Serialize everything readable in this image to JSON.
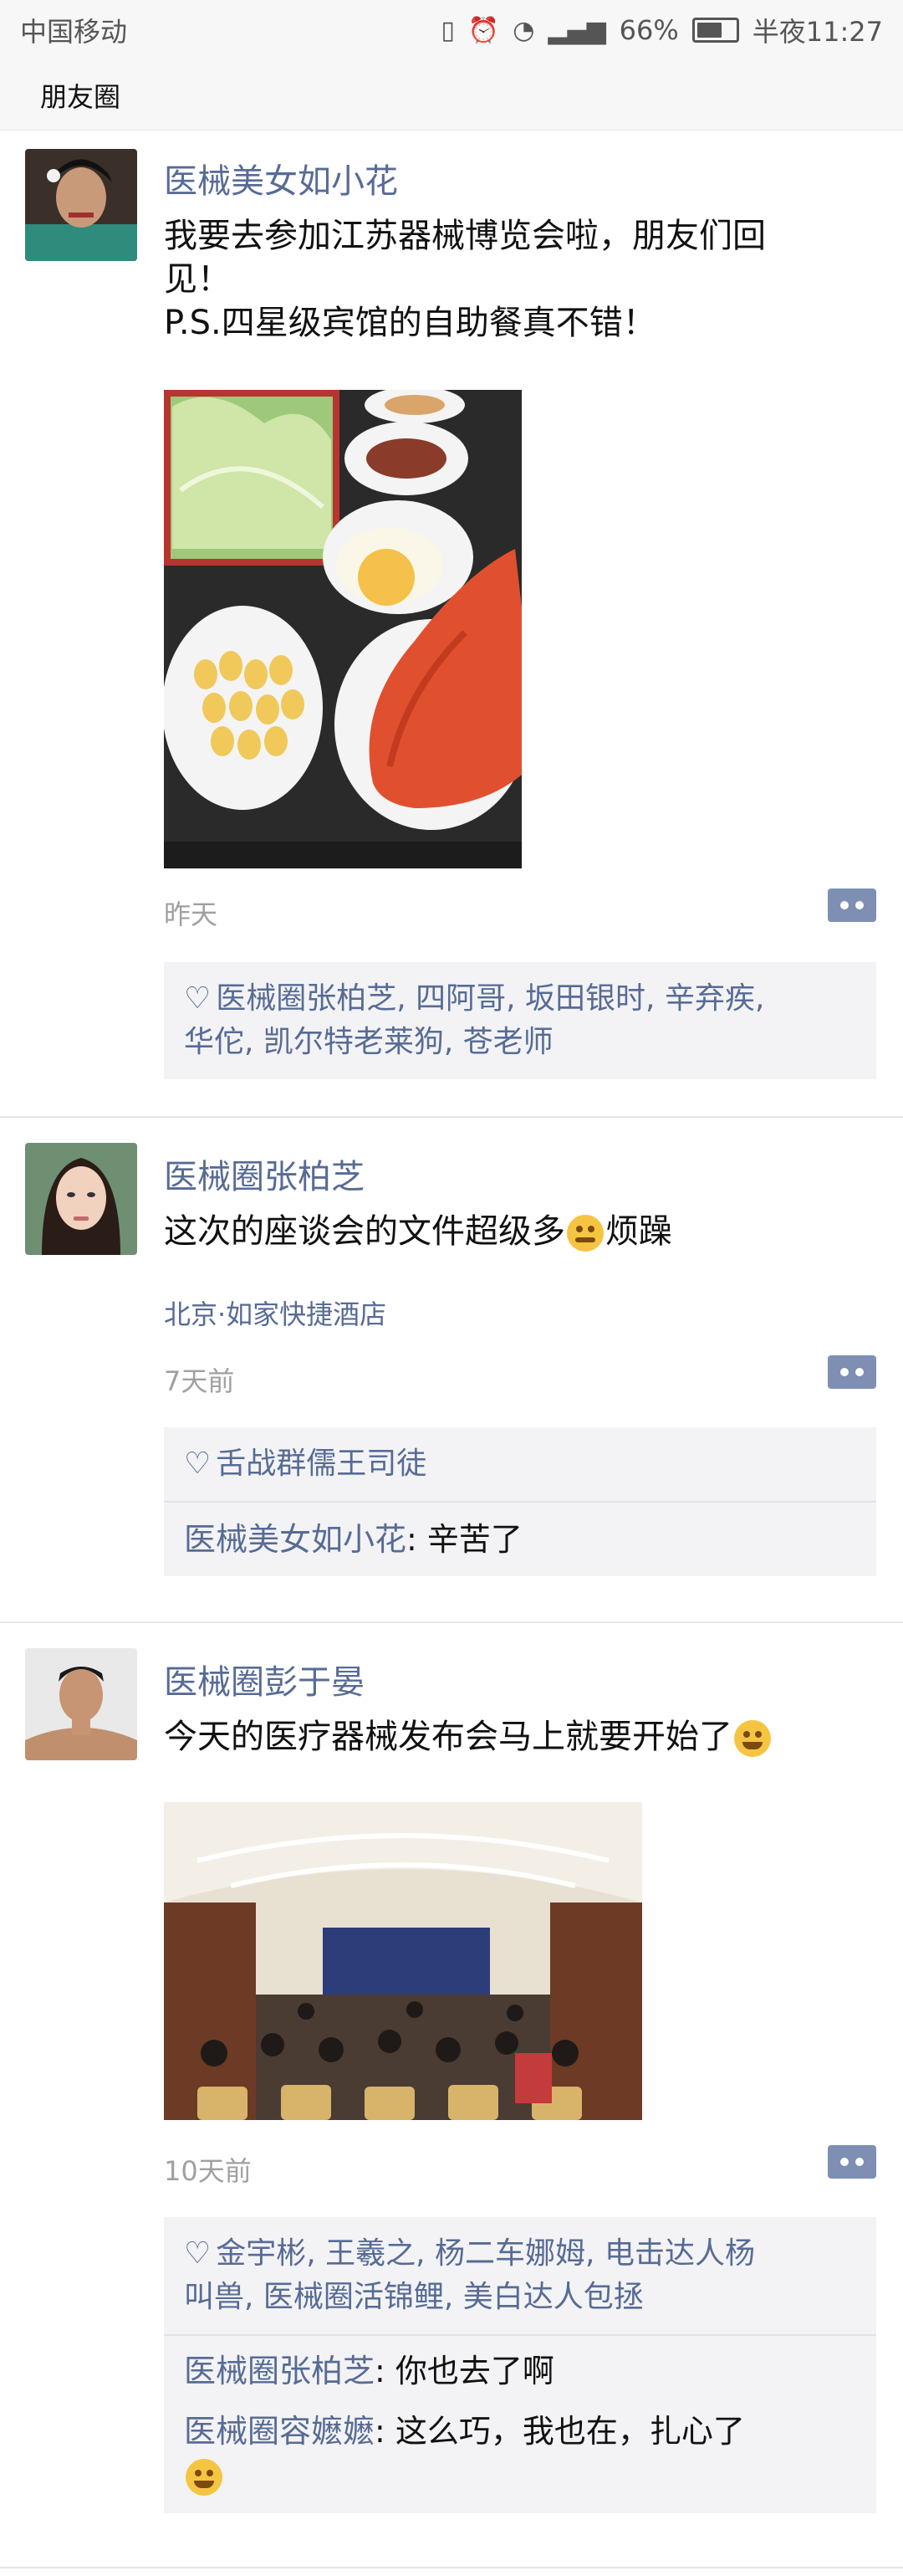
{
  "status_bar": {
    "carrier": "中国移动",
    "battery": "66%",
    "time": "半夜11:27",
    "battery_level": 0.66
  },
  "header": {
    "title": "朋友圈"
  },
  "posts": [
    {
      "name": "医械美女如小花",
      "text_lines": [
        "我要去参加江苏器械博览会啦，朋友们回",
        "见！",
        "P.S.四星级宾馆的自助餐真不错！"
      ],
      "time": "昨天",
      "likes": [
        "医械圈张柏芝, 四阿哥, 坂田银时, 辛弃疾,",
        "华佗, 凯尔特老莱狗, 苍老师"
      ]
    },
    {
      "name": "医械圈张柏芝",
      "text": "这次的座谈会的文件超级多",
      "text_after": "烦躁",
      "location": "北京·如家快捷酒店",
      "time": "7天前",
      "likes": [
        "舌战群儒王司徒"
      ],
      "comments": [
        {
          "who": "医械美女如小花",
          "sep": ": ",
          "text": "辛苦了"
        }
      ]
    },
    {
      "name": "医械圈彭于晏",
      "text": "今天的医疗器械发布会马上就要开始了",
      "time": "10天前",
      "likes": [
        "金宇彬, 王羲之, 杨二车娜姆, 电击达人杨",
        "叫兽, 医械圈活锦鲤, 美白达人包拯"
      ],
      "comments": [
        {
          "who": "医械圈张柏芝",
          "sep": ": ",
          "text": "你也去了啊"
        },
        {
          "who": "医械圈容嬷嬷",
          "sep": ": ",
          "text": "这么巧，我也在，扎心了"
        }
      ]
    }
  ],
  "colors": {
    "link": "#576b95",
    "comment_bg": "#f3f3f5",
    "more_button": "#7e8fb3"
  },
  "icons": [
    "vibrate-icon",
    "alarm-icon",
    "wifi-icon",
    "signal-icon",
    "battery-icon",
    "heart-icon",
    "more-icon",
    "grin-emoji-icon",
    "dizzy-emoji-icon"
  ]
}
